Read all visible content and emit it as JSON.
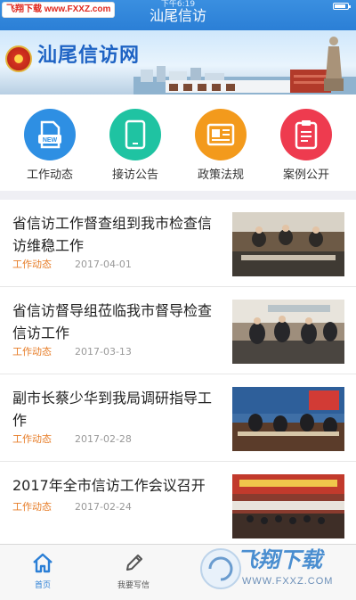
{
  "status_bar": {
    "time": "下午6:19"
  },
  "navbar": {
    "title": "汕尾信访"
  },
  "watermark_top": {
    "text": "飞翔下载 www.FXXZ.com"
  },
  "banner": {
    "title": "汕尾信访网"
  },
  "quick_menu": [
    {
      "label": "工作动态",
      "icon": "news-doc-icon",
      "color": "#2e8fe3"
    },
    {
      "label": "接访公告",
      "icon": "tablet-icon",
      "color": "#1fc3a2"
    },
    {
      "label": "政策法规",
      "icon": "newspaper-icon",
      "color": "#f39a1c"
    },
    {
      "label": "案例公开",
      "icon": "clipboard-icon",
      "color": "#ee3b4f"
    }
  ],
  "news": [
    {
      "title": "省信访工作督查组到我市检查信访维稳工作",
      "tag": "工作动态",
      "date": "2017-04-01"
    },
    {
      "title": "省信访督导组莅临我市督导检查信访工作",
      "tag": "工作动态",
      "date": "2017-03-13"
    },
    {
      "title": "副市长蔡少华到我局调研指导工作",
      "tag": "工作动态",
      "date": "2017-02-28"
    },
    {
      "title": "2017年全市信访工作会议召开",
      "tag": "工作动态",
      "date": "2017-02-24"
    }
  ],
  "tabbar": [
    {
      "label": "首页",
      "icon": "home-icon",
      "active": true,
      "color": "#2b7fd6"
    },
    {
      "label": "我要写信",
      "icon": "pencil-icon",
      "active": false,
      "color": "#555555"
    }
  ],
  "watermark_bottom": {
    "text": "飞翔下载",
    "url": "WWW.FXXZ.COM"
  }
}
